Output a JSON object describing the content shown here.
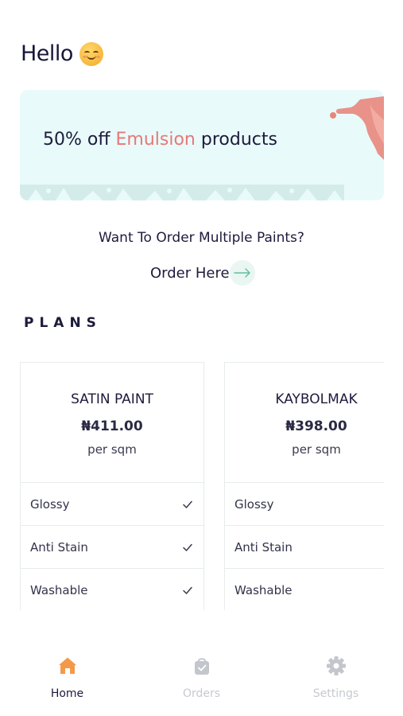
{
  "header": {
    "greeting": "Hello"
  },
  "banner": {
    "text_before": "50% off ",
    "text_accent": "Emulsion",
    "text_after": " products"
  },
  "cta": {
    "title": "Want To Order Multiple Paints?",
    "link_label": "Order Here"
  },
  "plans": {
    "title": "PLANS",
    "items": [
      {
        "name": "SATIN PAINT",
        "price": "₦411.00",
        "unit": "per sqm",
        "features": [
          {
            "label": "Glossy",
            "checked": true
          },
          {
            "label": "Anti Stain",
            "checked": true
          },
          {
            "label": "Washable",
            "checked": true
          }
        ]
      },
      {
        "name": "KAYBOLMAK",
        "price": "₦398.00",
        "unit": "per sqm",
        "features": [
          {
            "label": "Glossy",
            "checked": false
          },
          {
            "label": "Anti Stain",
            "checked": false
          },
          {
            "label": "Washable",
            "checked": false
          }
        ]
      }
    ]
  },
  "nav": {
    "items": [
      {
        "label": "Home",
        "icon": "home-icon",
        "active": true
      },
      {
        "label": "Orders",
        "icon": "shopping-bag-icon",
        "active": false
      },
      {
        "label": "Settings",
        "icon": "gear-icon",
        "active": false
      }
    ]
  },
  "colors": {
    "accent": "#e87878",
    "active_nav": "#f39a4a",
    "inactive_nav": "#c3c6cc",
    "banner_bg": "#e9fafa"
  }
}
